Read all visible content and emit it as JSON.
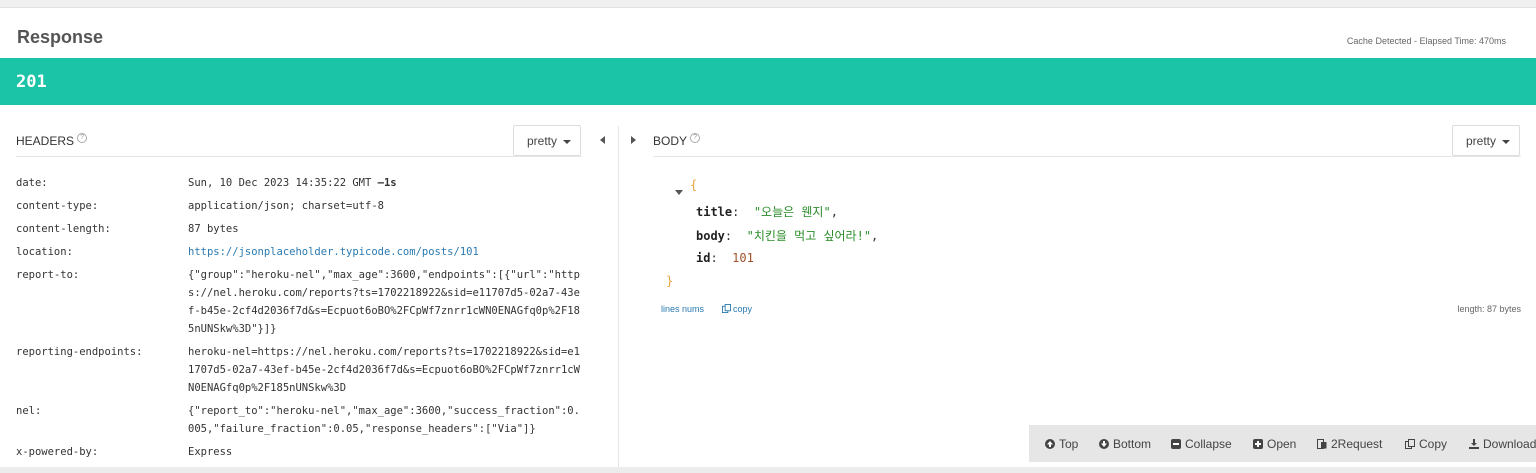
{
  "response": {
    "title": "Response",
    "meta": "Cache Detected - Elapsed Time: 470ms",
    "status_code": "201"
  },
  "headers_panel": {
    "title": "HEADERS",
    "format_label": "pretty",
    "rows": [
      {
        "key": "date:",
        "value": "Sun, 10 Dec 2023 14:35:22 GMT",
        "suffix": "–1s"
      },
      {
        "key": "content-type:",
        "value": "application/json; charset=utf-8"
      },
      {
        "key": "content-length:",
        "value": "87 bytes"
      },
      {
        "key": "location:",
        "value": "https://jsonplaceholder.typicode.com/posts/101"
      },
      {
        "key": "report-to:",
        "value": "{\"group\":\"heroku-nel\",\"max_age\":3600,\"endpoints\":[{\"url\":\"https://nel.heroku.com/reports?ts=1702218922&sid=e11707d5-02a7-43ef-b45e-2cf4d2036f7d&s=Ecpuot6oBO%2FCpWf7znrr1cWN0ENAGfq0p%2F185nUNSkw%3D\"}]}"
      },
      {
        "key": "reporting-endpoints:",
        "value": "heroku-nel=https://nel.heroku.com/reports?ts=1702218922&sid=e11707d5-02a7-43ef-b45e-2cf4d2036f7d&s=Ecpuot6oBO%2FCpWf7znrr1cWN0ENAGfq0p%2F185nUNSkw%3D"
      },
      {
        "key": "nel:",
        "value": "{\"report_to\":\"heroku-nel\",\"max_age\":3600,\"success_fraction\":0.005,\"failure_fraction\":0.05,\"response_headers\":[\"Via\"]}"
      },
      {
        "key": "x-powered-by:",
        "value": "Express"
      }
    ]
  },
  "body_panel": {
    "title": "BODY",
    "format_label": "pretty",
    "open_brace": "{",
    "close_brace": "}",
    "fields": [
      {
        "key": "title",
        "value": "\"오늘은 웬지\""
      },
      {
        "key": "body",
        "value": "\"치킨을 먹고 싶어라!\""
      },
      {
        "key": "id",
        "value": "101"
      }
    ],
    "lines_nums_label": "lines nums",
    "copy_label": "copy",
    "length_label": "length: 87 bytes"
  },
  "toolbar": {
    "top": "Top",
    "bottom": "Bottom",
    "collapse": "Collapse",
    "open": "Open",
    "to_request": "2Request",
    "copy": "Copy",
    "download": "Download"
  },
  "icons": {
    "help": "question-circle-icon",
    "caret": "caret-down-icon",
    "top": "arrow-up-circle-icon",
    "bottom": "arrow-down-circle-icon",
    "collapse": "minus-square-icon",
    "open": "plus-square-icon",
    "to_request": "share-icon",
    "copy": "copy-icon",
    "download": "download-icon"
  },
  "colors": {
    "status_bar": "#1bc4a7",
    "link": "#2a7ab0",
    "json_string": "#2a8c2a",
    "json_number": "#a0522d",
    "json_brace": "#e8a33d"
  }
}
